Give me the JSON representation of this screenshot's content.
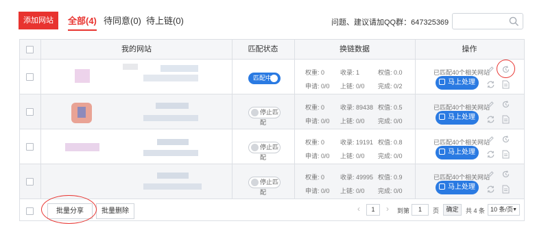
{
  "toolbar": {
    "add_label": "添加网站",
    "tabs": [
      {
        "label": "全部(4)",
        "active": true
      },
      {
        "label": "待同意(0)",
        "active": false
      },
      {
        "label": "待上链(0)",
        "active": false
      }
    ],
    "qq_text": "问题、建议请加QQ群：647325369",
    "search_icon": "search-icon"
  },
  "table": {
    "headers": {
      "site": "我的网站",
      "match_status": "匹配状态",
      "link_data": "换链数据",
      "actions": "操作"
    },
    "rows": [
      {
        "match_on": true,
        "match_label": "匹配中",
        "weight": "权重: 0",
        "included": "收录: 1",
        "weight2": "权值: 0.0",
        "apply": "申请: 0/0",
        "chain": "上链: 0/0",
        "done": "完成: 0/2",
        "matched": "已匹配40个相关网站",
        "process_label": "马上处理"
      },
      {
        "match_on": false,
        "match_label": "停止匹配",
        "weight": "权重: 0",
        "included": "收录: 89438",
        "weight2": "权值: 0.5",
        "apply": "申请: 0/0",
        "chain": "上链: 0/0",
        "done": "完成: 0/0",
        "matched": "已匹配40个相关网站",
        "process_label": "马上处理"
      },
      {
        "match_on": false,
        "match_label": "停止匹配",
        "weight": "权重: 0",
        "included": "收录: 19191",
        "weight2": "权值: 0.8",
        "apply": "申请: 0/0",
        "chain": "上链: 0/0",
        "done": "完成: 0/0",
        "matched": "已匹配40个相关网站",
        "process_label": "马上处理"
      },
      {
        "match_on": false,
        "match_label": "停止匹配",
        "weight": "权重: 0",
        "included": "收录: 49995",
        "weight2": "权值: 0.9",
        "apply": "申请: 0/0",
        "chain": "上链: 0/0",
        "done": "完成: 0/0",
        "matched": "已匹配40个相关网站",
        "process_label": "马上处理"
      }
    ]
  },
  "footer": {
    "batch_share": "批量分享",
    "batch_delete": "批量删除",
    "pagination": {
      "prev": "‹",
      "current_page": "1",
      "next": "›",
      "goto_label": "到第",
      "goto_value": "1",
      "page_unit": "页",
      "confirm": "确定",
      "total": "共 4 条",
      "page_size": "10 条/页"
    }
  },
  "colors": {
    "accent": "#e8332f",
    "primary": "#2a7ae2"
  }
}
